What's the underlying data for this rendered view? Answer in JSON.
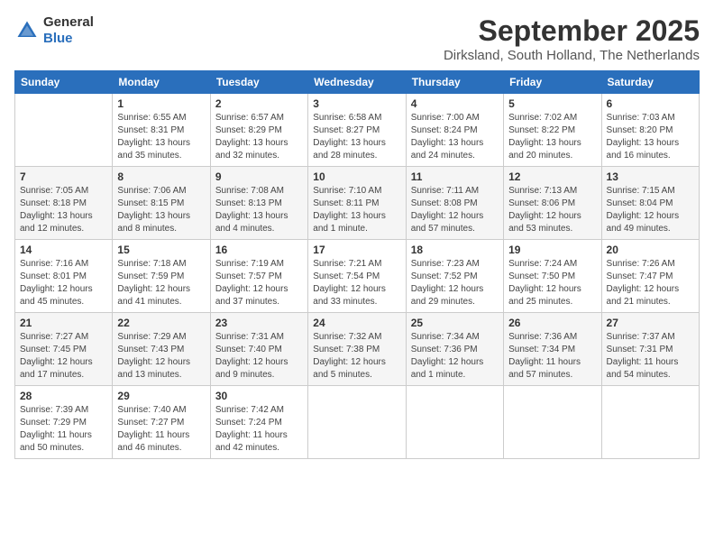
{
  "logo": {
    "general": "General",
    "blue": "Blue"
  },
  "header": {
    "month": "September 2025",
    "location": "Dirksland, South Holland, The Netherlands"
  },
  "weekdays": [
    "Sunday",
    "Monday",
    "Tuesday",
    "Wednesday",
    "Thursday",
    "Friday",
    "Saturday"
  ],
  "weeks": [
    [
      {
        "day": "",
        "sunrise": "",
        "sunset": "",
        "daylight": ""
      },
      {
        "day": "1",
        "sunrise": "Sunrise: 6:55 AM",
        "sunset": "Sunset: 8:31 PM",
        "daylight": "Daylight: 13 hours and 35 minutes."
      },
      {
        "day": "2",
        "sunrise": "Sunrise: 6:57 AM",
        "sunset": "Sunset: 8:29 PM",
        "daylight": "Daylight: 13 hours and 32 minutes."
      },
      {
        "day": "3",
        "sunrise": "Sunrise: 6:58 AM",
        "sunset": "Sunset: 8:27 PM",
        "daylight": "Daylight: 13 hours and 28 minutes."
      },
      {
        "day": "4",
        "sunrise": "Sunrise: 7:00 AM",
        "sunset": "Sunset: 8:24 PM",
        "daylight": "Daylight: 13 hours and 24 minutes."
      },
      {
        "day": "5",
        "sunrise": "Sunrise: 7:02 AM",
        "sunset": "Sunset: 8:22 PM",
        "daylight": "Daylight: 13 hours and 20 minutes."
      },
      {
        "day": "6",
        "sunrise": "Sunrise: 7:03 AM",
        "sunset": "Sunset: 8:20 PM",
        "daylight": "Daylight: 13 hours and 16 minutes."
      }
    ],
    [
      {
        "day": "7",
        "sunrise": "Sunrise: 7:05 AM",
        "sunset": "Sunset: 8:18 PM",
        "daylight": "Daylight: 13 hours and 12 minutes."
      },
      {
        "day": "8",
        "sunrise": "Sunrise: 7:06 AM",
        "sunset": "Sunset: 8:15 PM",
        "daylight": "Daylight: 13 hours and 8 minutes."
      },
      {
        "day": "9",
        "sunrise": "Sunrise: 7:08 AM",
        "sunset": "Sunset: 8:13 PM",
        "daylight": "Daylight: 13 hours and 4 minutes."
      },
      {
        "day": "10",
        "sunrise": "Sunrise: 7:10 AM",
        "sunset": "Sunset: 8:11 PM",
        "daylight": "Daylight: 13 hours and 1 minute."
      },
      {
        "day": "11",
        "sunrise": "Sunrise: 7:11 AM",
        "sunset": "Sunset: 8:08 PM",
        "daylight": "Daylight: 12 hours and 57 minutes."
      },
      {
        "day": "12",
        "sunrise": "Sunrise: 7:13 AM",
        "sunset": "Sunset: 8:06 PM",
        "daylight": "Daylight: 12 hours and 53 minutes."
      },
      {
        "day": "13",
        "sunrise": "Sunrise: 7:15 AM",
        "sunset": "Sunset: 8:04 PM",
        "daylight": "Daylight: 12 hours and 49 minutes."
      }
    ],
    [
      {
        "day": "14",
        "sunrise": "Sunrise: 7:16 AM",
        "sunset": "Sunset: 8:01 PM",
        "daylight": "Daylight: 12 hours and 45 minutes."
      },
      {
        "day": "15",
        "sunrise": "Sunrise: 7:18 AM",
        "sunset": "Sunset: 7:59 PM",
        "daylight": "Daylight: 12 hours and 41 minutes."
      },
      {
        "day": "16",
        "sunrise": "Sunrise: 7:19 AM",
        "sunset": "Sunset: 7:57 PM",
        "daylight": "Daylight: 12 hours and 37 minutes."
      },
      {
        "day": "17",
        "sunrise": "Sunrise: 7:21 AM",
        "sunset": "Sunset: 7:54 PM",
        "daylight": "Daylight: 12 hours and 33 minutes."
      },
      {
        "day": "18",
        "sunrise": "Sunrise: 7:23 AM",
        "sunset": "Sunset: 7:52 PM",
        "daylight": "Daylight: 12 hours and 29 minutes."
      },
      {
        "day": "19",
        "sunrise": "Sunrise: 7:24 AM",
        "sunset": "Sunset: 7:50 PM",
        "daylight": "Daylight: 12 hours and 25 minutes."
      },
      {
        "day": "20",
        "sunrise": "Sunrise: 7:26 AM",
        "sunset": "Sunset: 7:47 PM",
        "daylight": "Daylight: 12 hours and 21 minutes."
      }
    ],
    [
      {
        "day": "21",
        "sunrise": "Sunrise: 7:27 AM",
        "sunset": "Sunset: 7:45 PM",
        "daylight": "Daylight: 12 hours and 17 minutes."
      },
      {
        "day": "22",
        "sunrise": "Sunrise: 7:29 AM",
        "sunset": "Sunset: 7:43 PM",
        "daylight": "Daylight: 12 hours and 13 minutes."
      },
      {
        "day": "23",
        "sunrise": "Sunrise: 7:31 AM",
        "sunset": "Sunset: 7:40 PM",
        "daylight": "Daylight: 12 hours and 9 minutes."
      },
      {
        "day": "24",
        "sunrise": "Sunrise: 7:32 AM",
        "sunset": "Sunset: 7:38 PM",
        "daylight": "Daylight: 12 hours and 5 minutes."
      },
      {
        "day": "25",
        "sunrise": "Sunrise: 7:34 AM",
        "sunset": "Sunset: 7:36 PM",
        "daylight": "Daylight: 12 hours and 1 minute."
      },
      {
        "day": "26",
        "sunrise": "Sunrise: 7:36 AM",
        "sunset": "Sunset: 7:34 PM",
        "daylight": "Daylight: 11 hours and 57 minutes."
      },
      {
        "day": "27",
        "sunrise": "Sunrise: 7:37 AM",
        "sunset": "Sunset: 7:31 PM",
        "daylight": "Daylight: 11 hours and 54 minutes."
      }
    ],
    [
      {
        "day": "28",
        "sunrise": "Sunrise: 7:39 AM",
        "sunset": "Sunset: 7:29 PM",
        "daylight": "Daylight: 11 hours and 50 minutes."
      },
      {
        "day": "29",
        "sunrise": "Sunrise: 7:40 AM",
        "sunset": "Sunset: 7:27 PM",
        "daylight": "Daylight: 11 hours and 46 minutes."
      },
      {
        "day": "30",
        "sunrise": "Sunrise: 7:42 AM",
        "sunset": "Sunset: 7:24 PM",
        "daylight": "Daylight: 11 hours and 42 minutes."
      },
      {
        "day": "",
        "sunrise": "",
        "sunset": "",
        "daylight": ""
      },
      {
        "day": "",
        "sunrise": "",
        "sunset": "",
        "daylight": ""
      },
      {
        "day": "",
        "sunrise": "",
        "sunset": "",
        "daylight": ""
      },
      {
        "day": "",
        "sunrise": "",
        "sunset": "",
        "daylight": ""
      }
    ]
  ]
}
